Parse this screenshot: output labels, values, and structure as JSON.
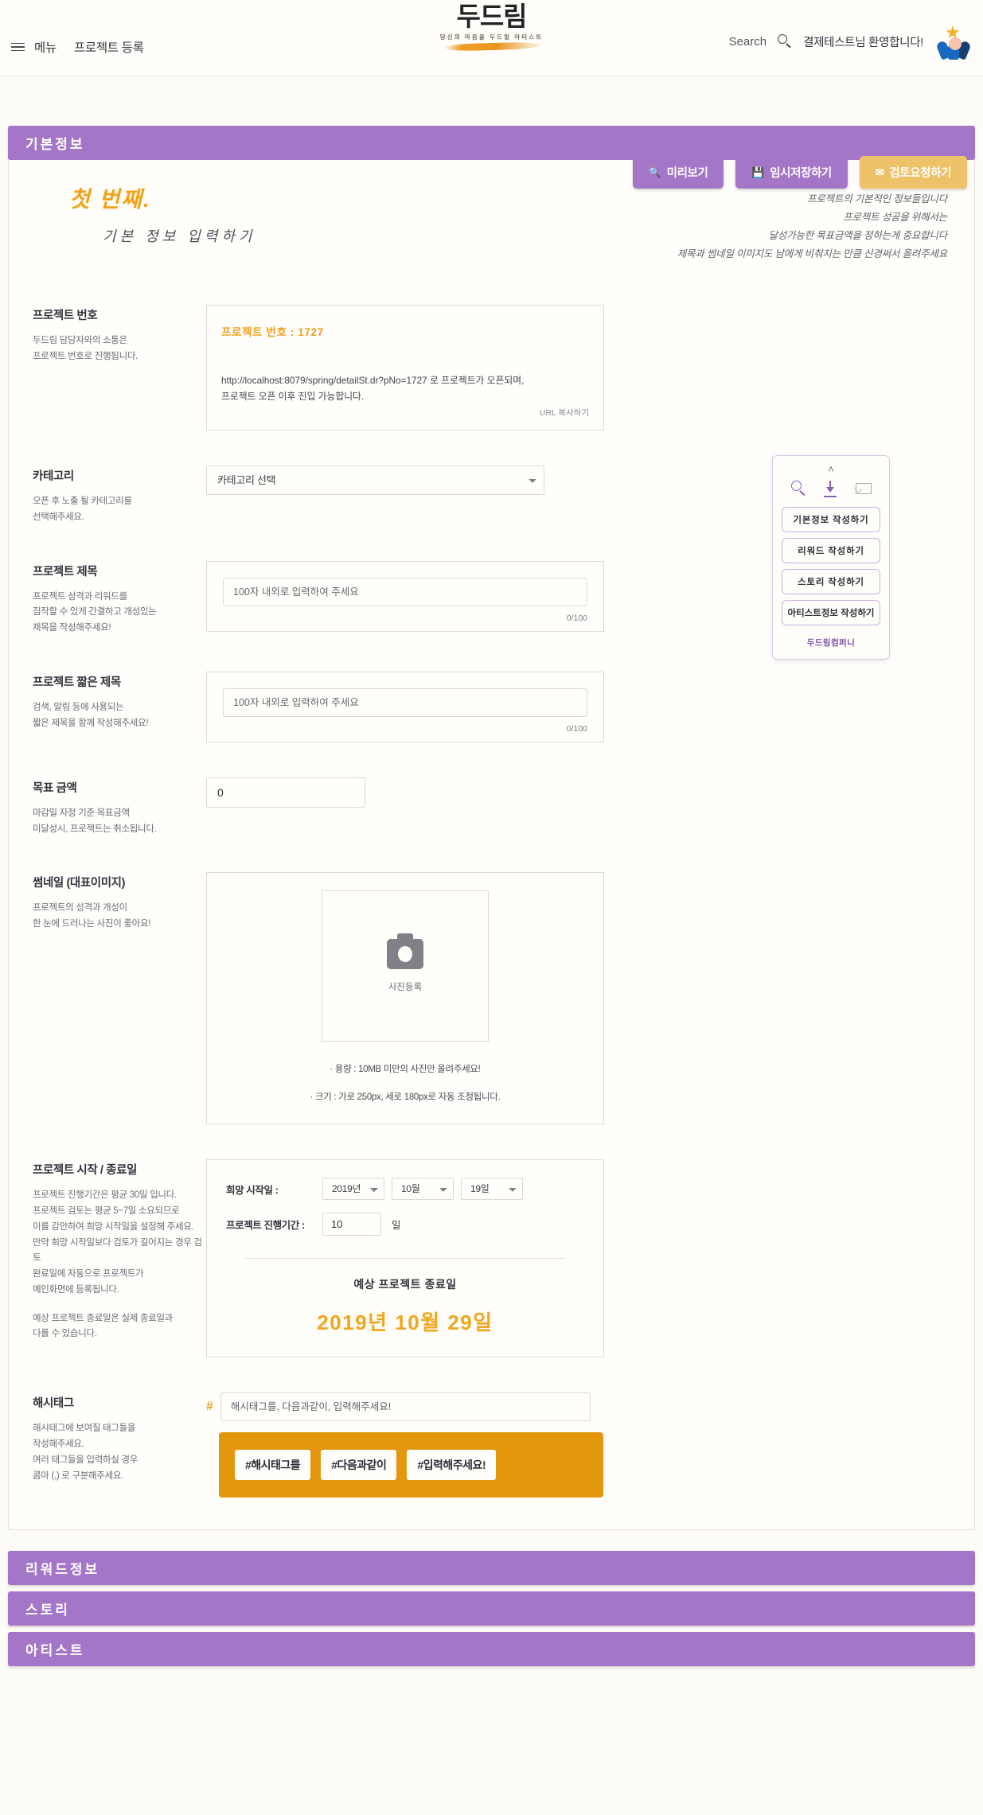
{
  "header": {
    "menu_label": "메뉴",
    "register_label": "프로젝트 등록",
    "logo_main": "두드림",
    "logo_tagline": "당신의 마음을 두드릴 아티스트",
    "search_label": "Search",
    "welcome_text": "결제테스트님 환영합니다!"
  },
  "toolbar": {
    "preview_label": "미리보기",
    "temp_save_label": "임시저장하기",
    "review_request_label": "검토요청하기",
    "preview_icon": "search-icon",
    "temp_save_icon": "save-icon",
    "review_icon": "mail-icon",
    "purple": "#a476c8",
    "gold": "#eec268"
  },
  "section": {
    "basic_info_title": "기본정보",
    "intro_first": "첫 번째.",
    "intro_second": "기본 정보 입력하기",
    "intro_right_lines": [
      "프로젝트의 기본적인 정보들입니다",
      "프로젝트 성공을 위해서는",
      "달성가능한 목표금액을 정하는게 중요합니다",
      "제목과 썸네일 이미지도 남에게 비춰지는 만큼 신경써서 올려주세요"
    ]
  },
  "project_number": {
    "label": "프로젝트 번호",
    "desc_lines": [
      "두드림 담당자와의 소통은",
      "프로젝트 번호로 진행됩니다."
    ],
    "box_title": "프로젝트 번호 : 1727",
    "number": "1727",
    "url_line1": "http://localhost:8079/spring/detailSt.dr?pNo=1727 로 프로젝트가 오픈되며,",
    "url_line2": "프로젝트 오픈 이후 진입 가능합니다.",
    "copy_label": "URL 복사하기"
  },
  "category": {
    "label": "카테고리",
    "desc_lines": [
      "오픈 후 노출 될 카테고리를",
      "선택해주세요."
    ],
    "selected": "카테고리 선택"
  },
  "project_title": {
    "label": "프로젝트 제목",
    "desc_lines": [
      "프로젝트 성격과 리워드를",
      "짐작할 수 있게 간결하고 개성있는",
      "제목을 작성해주세요!"
    ],
    "placeholder": "100자 내외로 입력하여 주세요",
    "value": "",
    "counter": "0/100"
  },
  "short_title": {
    "label": "프로젝트 짧은 제목",
    "desc_lines": [
      "검색, 알림 등에 사용되는",
      "짧은 제목을 함께 작성해주세요!"
    ],
    "placeholder": "100자 내외로 입력하여 주세요",
    "value": "",
    "counter": "0/100"
  },
  "goal_amount": {
    "label": "목표 금액",
    "desc_lines": [
      "마감일 자정 기준 목표금액",
      "미달성시, 프로젝트는 취소됩니다."
    ],
    "value": "0"
  },
  "thumbnail": {
    "label": "썸네일 (대표이미지)",
    "desc_lines": [
      "프로젝트의 성격과 개성이",
      "한 눈에 드러나는 사진이 좋아요!"
    ],
    "upload_label": "사진등록",
    "note1": "· 용량 : 10MB 미만의 사진만 올려주세요!",
    "note2": "· 크기 : 가로 250px, 세로 180px로 자동 조정됩니다."
  },
  "schedule": {
    "label": "프로젝트 시작 / 종료일",
    "desc_lines": [
      "프로젝트 진행기간은 평균 30일 입니다.",
      "프로젝트 검토는 평균 5~7일 소요되므로",
      "이를 감안하여 희망 시작일을 설정해 주세요.",
      "만약 희망 시작일보다 검토가 길어지는 경우 검토",
      "완료일에 자동으로 프로젝트가",
      "메인화면에 등록됩니다."
    ],
    "desc_lines2": [
      "예상 프로젝트 종료일은 실제 종료일과",
      "다를 수 있습니다."
    ],
    "start_label": "희망 시작일 :",
    "year": "2019년",
    "month": "10월",
    "day": "19일",
    "duration_label": "프로젝트 진행기간 :",
    "duration_value": "10",
    "duration_unit": "일",
    "end_label": "예상 프로젝트 종료일",
    "end_date": "2019년 10월 29일"
  },
  "hashtag": {
    "label": "해시태그",
    "desc_lines": [
      "해시태그에 보여질 태그들을",
      "작성해주세요.",
      "여러 태그들을 입력하실 경우",
      "콤마 (,) 로 구분해주세요."
    ],
    "symbol": "#",
    "placeholder": "해시태그를, 다음과같이, 입력해주세요!",
    "value": "",
    "chips": [
      "#해시태그를",
      "#다음과같이",
      "#입력해주세요!"
    ],
    "preview_bg": "#e2970c"
  },
  "bottom_sections": [
    {
      "title": "리워드정보"
    },
    {
      "title": "스토리"
    },
    {
      "title": "아티스트"
    }
  ],
  "float_panel": {
    "caret": "˄",
    "icons": [
      "search-icon",
      "download-icon",
      "mail-icon"
    ],
    "buttons": [
      "기본정보 작성하기",
      "리워드 작성하기",
      "스토리 작성하기",
      "아티스트정보 작성하기"
    ],
    "brand": "두드림컴퍼니"
  }
}
